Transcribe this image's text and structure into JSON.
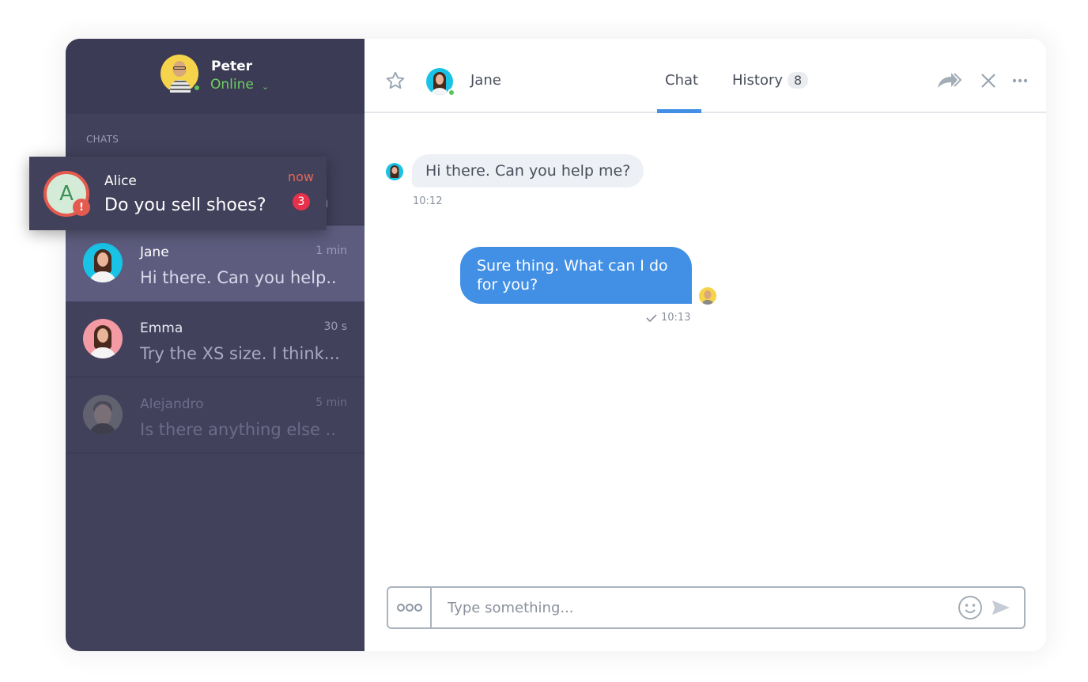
{
  "user": {
    "name": "Peter",
    "status": "Online",
    "status_color": "#6fcf5f"
  },
  "sidebar": {
    "section_label": "CHATS",
    "chats": [
      {
        "name": "Alice",
        "time": "now",
        "preview": "Do you sell shoes?",
        "unread": "3"
      },
      {
        "name": "Jane",
        "time": "1 min",
        "preview": "Hi there. Can you help..",
        "active": true
      },
      {
        "name": "Emma",
        "time": "30 s",
        "preview": "Try the XS size. I think..."
      },
      {
        "name": "Alejandro",
        "time": "5 min",
        "preview": "Is there anything else ..",
        "dimmed": true
      }
    ]
  },
  "notification": {
    "avatar_letter": "A",
    "name": "Alice",
    "message": "Do you sell shoes?",
    "time": "now",
    "unread": "3",
    "alert_glyph": "!"
  },
  "header": {
    "contact_name": "Jane",
    "tabs": [
      {
        "label": "Chat",
        "active": true
      },
      {
        "label": "History",
        "count": "8"
      }
    ],
    "icons": [
      "star-icon",
      "forward-icon",
      "close-icon",
      "more-icon"
    ]
  },
  "messages": [
    {
      "direction": "incoming",
      "text": "Hi there. Can you help me?",
      "time": "10:12"
    },
    {
      "direction": "outgoing",
      "text": "Sure thing. What can I do for you?",
      "time": "10:13",
      "read": true
    }
  ],
  "composer": {
    "placeholder": "Type something...",
    "value": ""
  },
  "colors": {
    "sidebar": "#42415c",
    "accent": "#4190e6",
    "alert": "#e55a4f",
    "badge": "#e8304a"
  }
}
